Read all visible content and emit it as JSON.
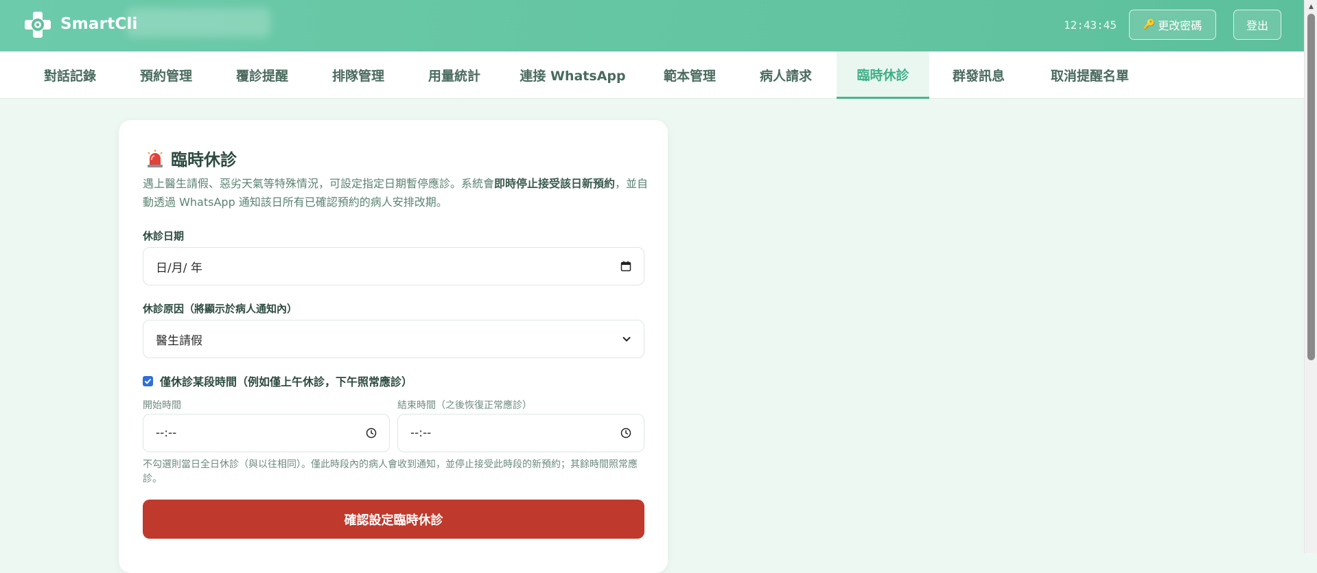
{
  "header": {
    "brand": "SmartCli",
    "time": "12:43:45",
    "change_password": "更改密碼",
    "logout": "登出"
  },
  "tabs": [
    {
      "label": "對話記錄"
    },
    {
      "label": "預約管理"
    },
    {
      "label": "覆診提醒"
    },
    {
      "label": "排隊管理"
    },
    {
      "label": "用量統計"
    },
    {
      "label": "連接 WhatsApp"
    },
    {
      "label": "範本管理"
    },
    {
      "label": "病人請求"
    },
    {
      "label": "臨時休診",
      "active": true
    },
    {
      "label": "群發訊息"
    },
    {
      "label": "取消提醒名單"
    }
  ],
  "closure": {
    "title": "臨時休診",
    "desc_part1": "遇上醫生請假、惡劣天氣等特殊情況，可設定指定日期暫停應診。系統會",
    "desc_bold": "即時停止接受該日新預約",
    "desc_part2": "，並自動透過 WhatsApp 通知該日所有已確認預約的病人安排改期。",
    "date_label": "休診日期",
    "date_value": "日/月/ 年",
    "reason_label": "休診原因（將顯示於病人通知內）",
    "reason_value": "醫生請假",
    "partial_checkbox_label": "僅休診某段時間（例如僅上午休診，下午照常應診）",
    "partial_checked": true,
    "start_label": "開始時間",
    "start_value": "--:--",
    "end_label": "結束時間（之後恢復正常應診）",
    "end_value": "--:--",
    "hint": "不勾選則當日全日休診（與以往相同）。僅此時段內的病人會收到通知，並停止接受此時段的新預約；其餘時間照常應診。",
    "submit": "確認設定臨時休診"
  },
  "colors": {
    "header_green": "#5dc09c",
    "active_tab": "#3fae88",
    "submit_red": "#bf3a2c",
    "checkbox_blue": "#2f6fd6"
  },
  "icons": {
    "logo": "clinic-cross-logo",
    "key": "key-icon",
    "siren": "siren-icon",
    "calendar": "calendar-icon",
    "dropdown": "chevron-down-icon",
    "time": "clock-icon",
    "checkbox": "checkmark-icon"
  }
}
